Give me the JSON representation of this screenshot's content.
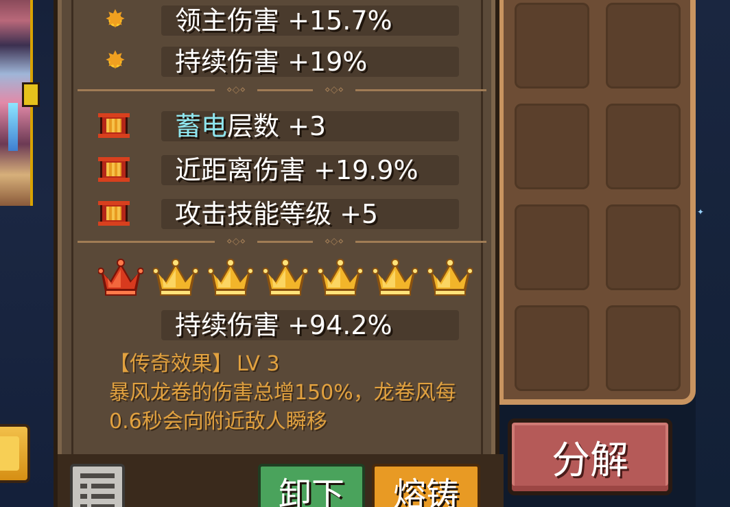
{
  "stats_top": [
    {
      "icon": "sun-icon",
      "text": "领主伤害 +15.7%"
    },
    {
      "icon": "sun-icon",
      "text": "持续伤害 +19%"
    }
  ],
  "stats_mid": [
    {
      "icon": "scroll-icon",
      "highlight": "蓄电",
      "text": "层数 +3"
    },
    {
      "icon": "scroll-icon",
      "highlight": "",
      "text": "近距离伤害 +19.9%"
    },
    {
      "icon": "scroll-icon",
      "highlight": "",
      "text": "攻击技能等级 +5"
    }
  ],
  "crowns": {
    "total": 7,
    "red_count": 1,
    "bonus_text": "持续伤害 +94.2%"
  },
  "legend": {
    "title": "【传奇效果】",
    "level": "LV 3",
    "description": "暴风龙卷的伤害总增150%，龙卷风每0.6秒会向附近敌人瞬移"
  },
  "buttons": {
    "unload": "卸下",
    "forge": "熔铸",
    "decompose": "分解"
  },
  "colors": {
    "highlight": "#8fe6ef",
    "legend_text": "#e1a13f",
    "unload_btn": "#4aa35c",
    "forge_btn": "#e89a24",
    "decompose_btn": "#b55a58"
  }
}
